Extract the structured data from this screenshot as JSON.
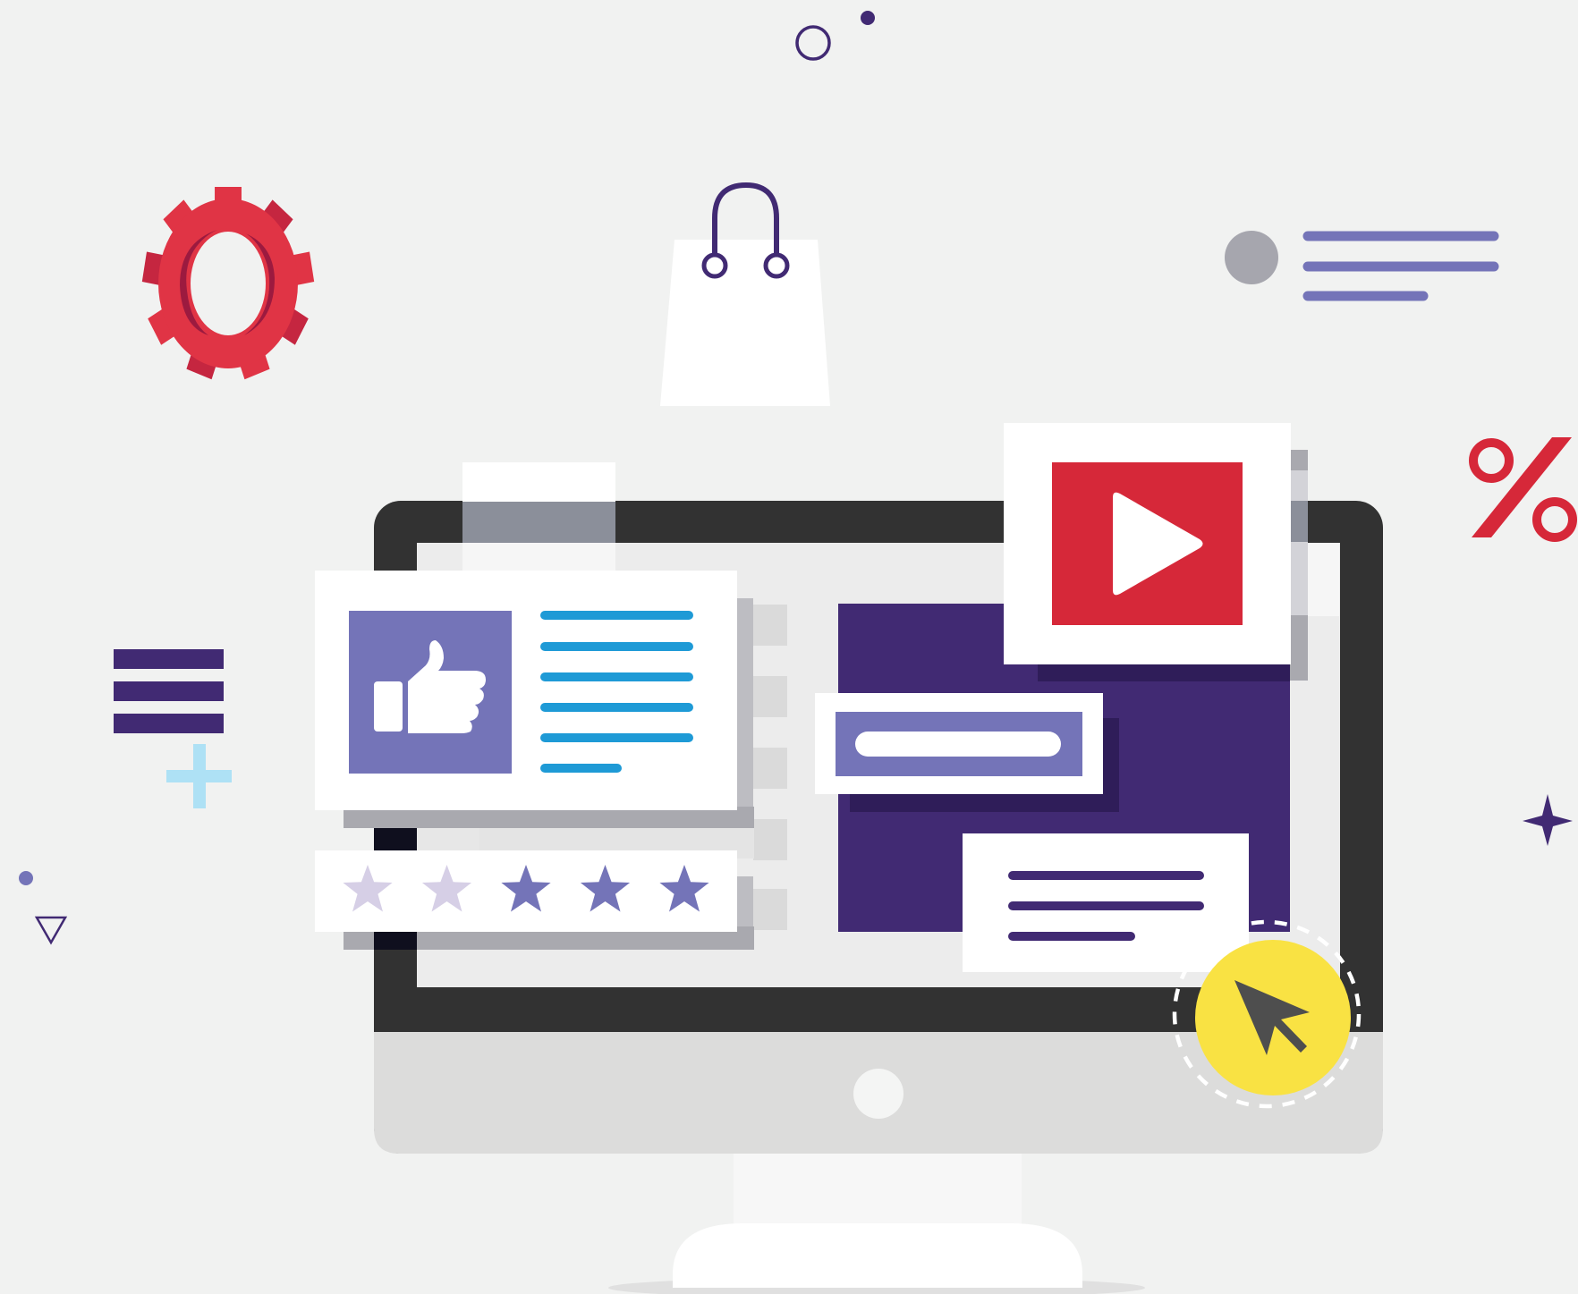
{
  "illustration": {
    "theme": "digital-marketing",
    "star_rating": {
      "filled": 3,
      "total": 5
    },
    "percent_symbol": "%",
    "colors": {
      "background": "#f1f2f1",
      "accent_purple": "#412a73",
      "soft_purple": "#7474b8",
      "red": "#d62839",
      "yellow": "#f9e243",
      "blue_text_lines": "#1e9ad6",
      "monitor_frame": "#323232",
      "monitor_chin": "#dcdcdb"
    }
  }
}
